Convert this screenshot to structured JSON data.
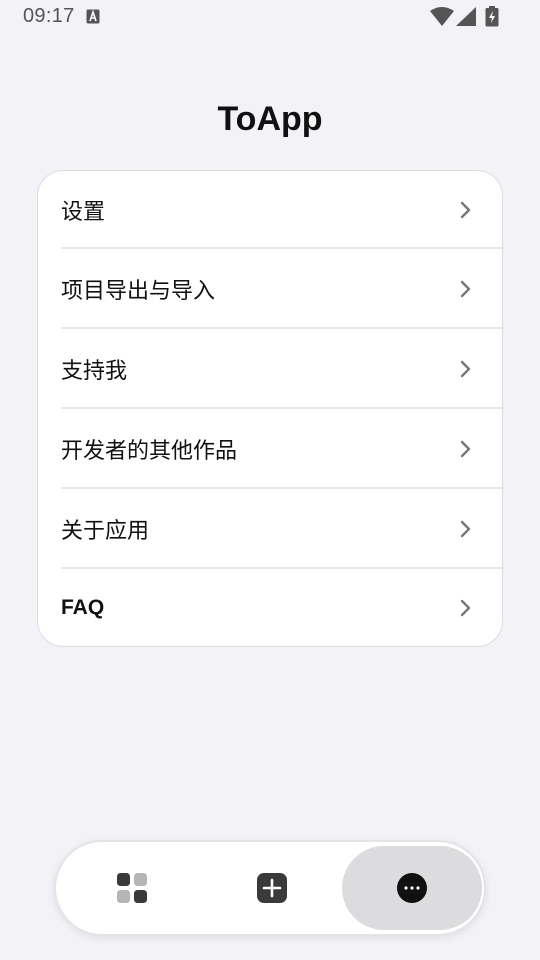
{
  "status_bar": {
    "time": "09:17",
    "icons": [
      "a-notification-icon",
      "wifi-icon",
      "signal-icon",
      "battery-charging-icon"
    ]
  },
  "header": {
    "title": "ToApp"
  },
  "menu": {
    "items": [
      {
        "label": "设置",
        "icon": "chevron-right-icon"
      },
      {
        "label": "项目导出与导入",
        "icon": "chevron-right-icon"
      },
      {
        "label": "支持我",
        "icon": "chevron-right-icon"
      },
      {
        "label": "开发者的其他作品",
        "icon": "chevron-right-icon"
      },
      {
        "label": "关于应用",
        "icon": "chevron-right-icon"
      },
      {
        "label": "FAQ",
        "icon": "chevron-right-icon"
      }
    ]
  },
  "bottom_nav": {
    "items": [
      {
        "icon": "apps-grid-icon",
        "active": false
      },
      {
        "icon": "add-box-icon",
        "active": false
      },
      {
        "icon": "more-horizontal-icon",
        "active": true
      }
    ]
  },
  "colors": {
    "background": "#f2f2f7",
    "card": "#ffffff",
    "active_nav": "#dcdcde",
    "text": "#111111"
  }
}
